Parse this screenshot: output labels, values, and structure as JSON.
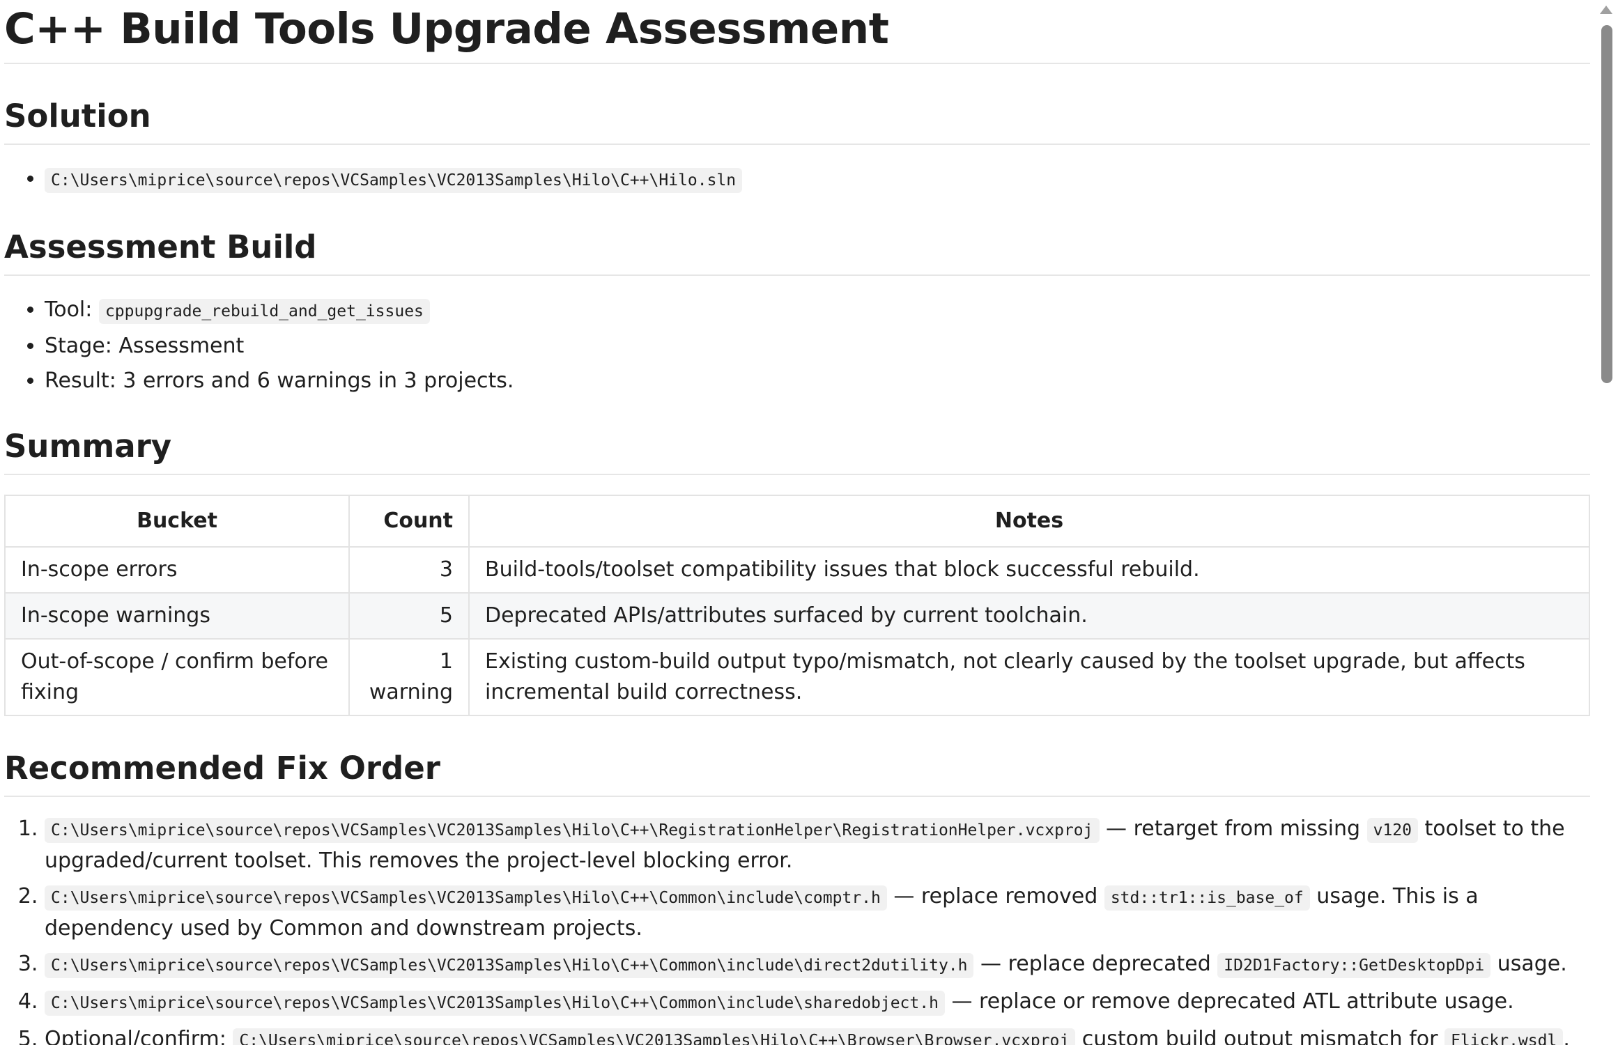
{
  "title": "C++ Build Tools Upgrade Assessment",
  "solution": {
    "heading": "Solution",
    "path": "C:\\Users\\miprice\\source\\repos\\VCSamples\\VC2013Samples\\Hilo\\C++\\Hilo.sln"
  },
  "assessment_build": {
    "heading": "Assessment Build",
    "tool_label": "Tool:",
    "tool_value": "cppupgrade_rebuild_and_get_issues",
    "stage_text": "Stage: Assessment",
    "result_text": "Result: 3 errors and 6 warnings in 3 projects."
  },
  "summary": {
    "heading": "Summary",
    "columns": [
      "Bucket",
      "Count",
      "Notes"
    ],
    "rows": [
      {
        "bucket": "In-scope errors",
        "count": "3",
        "notes": "Build-tools/toolset compatibility issues that block successful rebuild."
      },
      {
        "bucket": "In-scope warnings",
        "count": "5",
        "notes": "Deprecated APIs/attributes surfaced by current toolchain."
      },
      {
        "bucket": "Out-of-scope / confirm before fixing",
        "count": "1 warning",
        "notes": "Existing custom-build output typo/mismatch, not clearly caused by the toolset upgrade, but affects incremental build correctness."
      }
    ]
  },
  "fix_order": {
    "heading": "Recommended Fix Order",
    "items": [
      {
        "path": "C:\\Users\\miprice\\source\\repos\\VCSamples\\VC2013Samples\\Hilo\\C++\\RegistrationHelper\\RegistrationHelper.vcxproj",
        "text_a": " — retarget from missing ",
        "code_b": "v120",
        "text_c": " toolset to the upgraded/current toolset. This removes the project-level blocking error."
      },
      {
        "path": "C:\\Users\\miprice\\source\\repos\\VCSamples\\VC2013Samples\\Hilo\\C++\\Common\\include\\comptr.h",
        "text_a": " — replace removed ",
        "code_b": "std::tr1::is_base_of",
        "text_c": " usage. This is a dependency used by Common and downstream projects."
      },
      {
        "path": "C:\\Users\\miprice\\source\\repos\\VCSamples\\VC2013Samples\\Hilo\\C++\\Common\\include\\direct2dutility.h",
        "text_a": " — replace deprecated ",
        "code_b": "ID2D1Factory::GetDesktopDpi",
        "text_c": " usage."
      },
      {
        "path": "C:\\Users\\miprice\\source\\repos\\VCSamples\\VC2013Samples\\Hilo\\C++\\Common\\include\\sharedobject.h",
        "text_a": " — replace or remove deprecated ATL attribute usage."
      },
      {
        "prefix": "Optional/confirm: ",
        "path": "C:\\Users\\miprice\\source\\repos\\VCSamples\\VC2013Samples\\Hilo\\C++\\Browser\\Browser.vcxproj",
        "text_a": " custom build output mismatch for ",
        "code_b": "Flickr.wsdl",
        "text_c": "."
      }
    ]
  }
}
